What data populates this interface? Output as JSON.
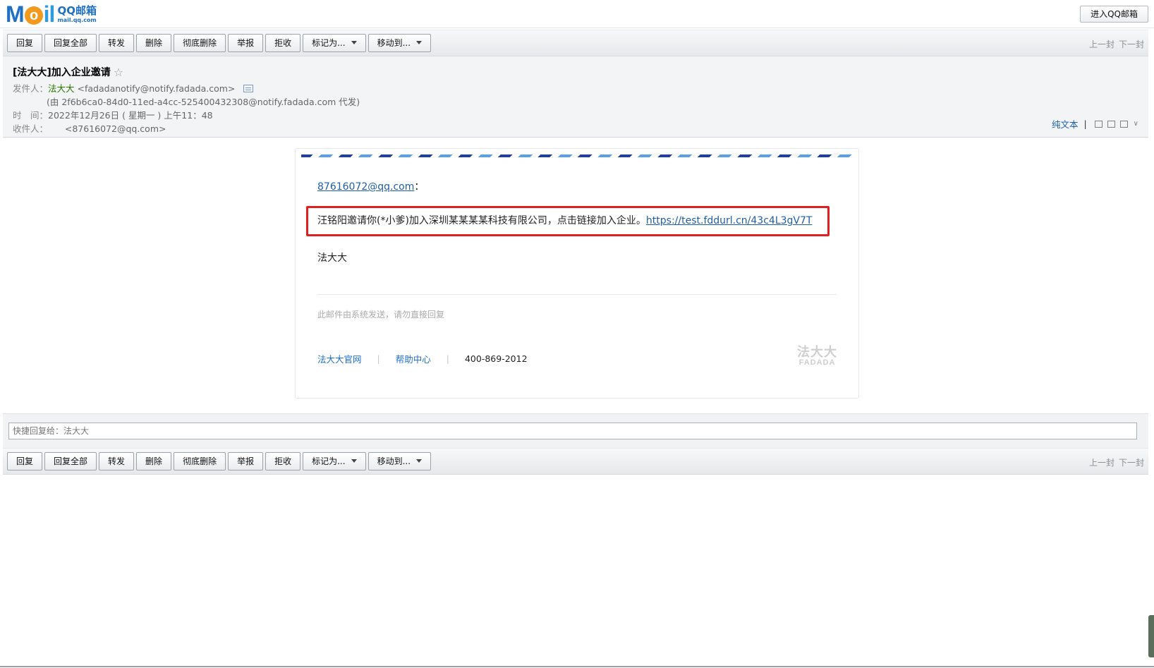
{
  "header": {
    "logo_mark_m": "M",
    "logo_mark_o": "o",
    "logo_mark_il": "il",
    "logo_cn": "QQ邮箱",
    "logo_domain": "mail.qq.com",
    "enter_button": "进入QQ邮箱"
  },
  "toolbar": {
    "reply": "回复",
    "reply_all": "回复全部",
    "forward": "转发",
    "delete": "删除",
    "delete_permanently": "彻底删除",
    "report": "举报",
    "reject": "拒收",
    "mark_as": "标记为...",
    "move_to": "移动到...",
    "prev": "上一封",
    "next": "下一封"
  },
  "mail": {
    "subject": "[法大大]加入企业邀请",
    "star_icon": "☆",
    "sender_label": "发件人：",
    "sender_name": "法大大",
    "sender_email": "<fadadanotify@notify.fadada.com>",
    "on_behalf": "(由 2f6b6ca0-84d0-11ed-a4cc-525400432308@notify.fadada.com 代发)",
    "time_label": "时　间：",
    "time_value": "2022年12月26日 ( 星期一 ) 上午11：48",
    "recipient_label": "收件人：",
    "recipient_value": "<87616072@qq.com>",
    "plain_text": "纯文本",
    "view_sep": "|"
  },
  "body": {
    "greeting_email": "87616072@qq.com",
    "greeting_suffix": "：",
    "invite_text": "汪铭阳邀请你(*小爹)加入深圳某某某某科技有限公司，点击链接加入企业。",
    "invite_link": "https://test.fddurl.cn/43c4L3gV7T",
    "signature": "法大大",
    "notice": "此邮件由系统发送，请勿直接回复",
    "footer_official": "法大大官网",
    "footer_help": "帮助中心",
    "footer_sep": "|",
    "footer_phone": "400-869-2012",
    "brand_cn": "法大大",
    "brand_en": "FADADA"
  },
  "quick_reply": {
    "placeholder": "快捷回复给：法大大"
  }
}
